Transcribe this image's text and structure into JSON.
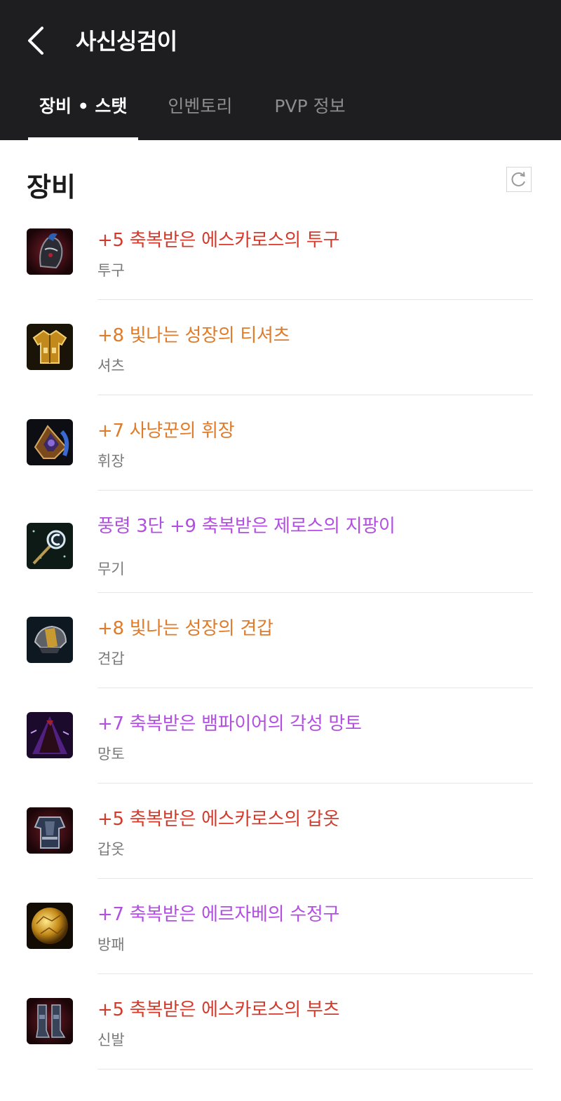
{
  "header": {
    "title": "사신싱검이",
    "back_icon": "chevron-left-icon"
  },
  "tabs": [
    {
      "label": "장비 • 스탯",
      "active": true
    },
    {
      "label": "인벤토리",
      "active": false
    },
    {
      "label": "PVP 정보",
      "active": false
    }
  ],
  "section": {
    "title": "장비",
    "refresh_icon": "refresh-icon"
  },
  "colors": {
    "header_bg": "#1e1e20",
    "grade_red": "#d23a2c",
    "grade_orange": "#e07b29",
    "grade_purple": "#b24fe0"
  },
  "items": [
    {
      "name": "+5  축복받은 에스카로스의 투구",
      "type": "투구",
      "grade": "red",
      "icon": "helmet-icon"
    },
    {
      "name": "+8  빛나는 성장의 티셔츠",
      "type": "셔츠",
      "grade": "orange",
      "icon": "shirt-icon"
    },
    {
      "name": "+7  사냥꾼의 휘장",
      "type": "휘장",
      "grade": "orange",
      "icon": "insignia-icon"
    },
    {
      "name": "풍령 3단 +9  축복받은 제로스의 지팡이",
      "type": "무기",
      "grade": "purple",
      "icon": "staff-icon"
    },
    {
      "name": "+8  빛나는 성장의 견갑",
      "type": "견갑",
      "grade": "orange",
      "icon": "shoulder-guard-icon"
    },
    {
      "name": "+7  축복받은 뱀파이어의 각성 망토",
      "type": "망토",
      "grade": "purple",
      "icon": "cloak-icon"
    },
    {
      "name": "+5  축복받은 에스카로스의 갑옷",
      "type": "갑옷",
      "grade": "red",
      "icon": "armor-icon"
    },
    {
      "name": "+7  축복받은 에르자베의 수정구",
      "type": "방패",
      "grade": "purple",
      "icon": "crystal-orb-icon"
    },
    {
      "name": "+5  축복받은 에스카로스의 부츠",
      "type": "신발",
      "grade": "red",
      "icon": "boots-icon"
    }
  ]
}
